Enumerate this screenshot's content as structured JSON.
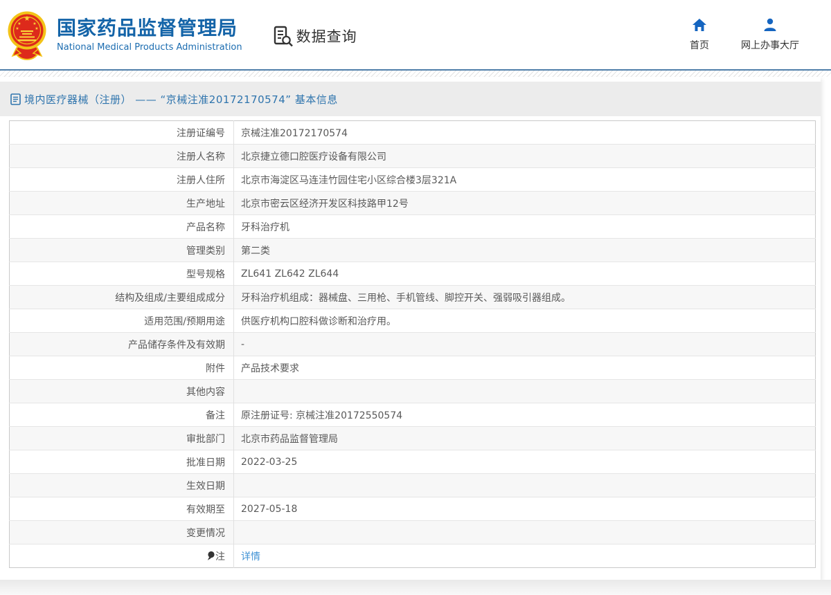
{
  "header": {
    "brand": {
      "title_cn": "国家药品监督管理局",
      "title_en": "National Medical Products Administration",
      "emblem": "china-national-emblem"
    },
    "data_query_label": "数据查询",
    "nav": [
      {
        "label": "首页",
        "icon": "home-icon"
      },
      {
        "label": "网上办事大厅",
        "icon": "user-icon"
      }
    ]
  },
  "section": {
    "title": "境内医疗器械（注册） —— “京械注准20172170574” 基本信息",
    "icon": "document-icon"
  },
  "table": {
    "rows": [
      {
        "label": "注册证编号",
        "value": "京械注准20172170574"
      },
      {
        "label": "注册人名称",
        "value": "北京捷立德口腔医疗设备有限公司"
      },
      {
        "label": "注册人住所",
        "value": "北京市海淀区马连洼竹园住宅小区综合楼3层321A"
      },
      {
        "label": "生产地址",
        "value": "北京市密云区经济开发区科技路甲12号"
      },
      {
        "label": "产品名称",
        "value": "牙科治疗机"
      },
      {
        "label": "管理类别",
        "value": "第二类"
      },
      {
        "label": "型号规格",
        "value": "ZL641 ZL642 ZL644"
      },
      {
        "label": "结构及组成/主要组成成分",
        "value": "牙科治疗机组成：器械盘、三用枪、手机管线、脚控开关、强弱吸引器组成。"
      },
      {
        "label": "适用范围/预期用途",
        "value": "供医疗机构口腔科做诊断和治疗用。"
      },
      {
        "label": "产品储存条件及有效期",
        "value": "-"
      },
      {
        "label": "附件",
        "value": "产品技术要求"
      },
      {
        "label": "其他内容",
        "value": ""
      },
      {
        "label": "备注",
        "value": "原注册证号: 京械注准20172550574"
      },
      {
        "label": "审批部门",
        "value": "北京市药品监督管理局"
      },
      {
        "label": "批准日期",
        "value": "2022-03-25"
      },
      {
        "label": "生效日期",
        "value": ""
      },
      {
        "label": "有效期至",
        "value": "2027-05-18"
      },
      {
        "label": "变更情况",
        "value": ""
      },
      {
        "label": "注",
        "label_icon": "pin-icon",
        "value": "详情",
        "link": true
      }
    ]
  },
  "colors": {
    "brand_blue": "#1464a8",
    "nav_blue": "#1565c0",
    "section_title_blue": "#2e74ad",
    "link_blue": "#4193d5",
    "divider_blue": "#4f7ea9",
    "titlebar_bg": "#ececec",
    "row_alt_bg": "#f7f7f7",
    "emblem_red": "#dd2a1b",
    "emblem_gold": "#f3c318"
  }
}
